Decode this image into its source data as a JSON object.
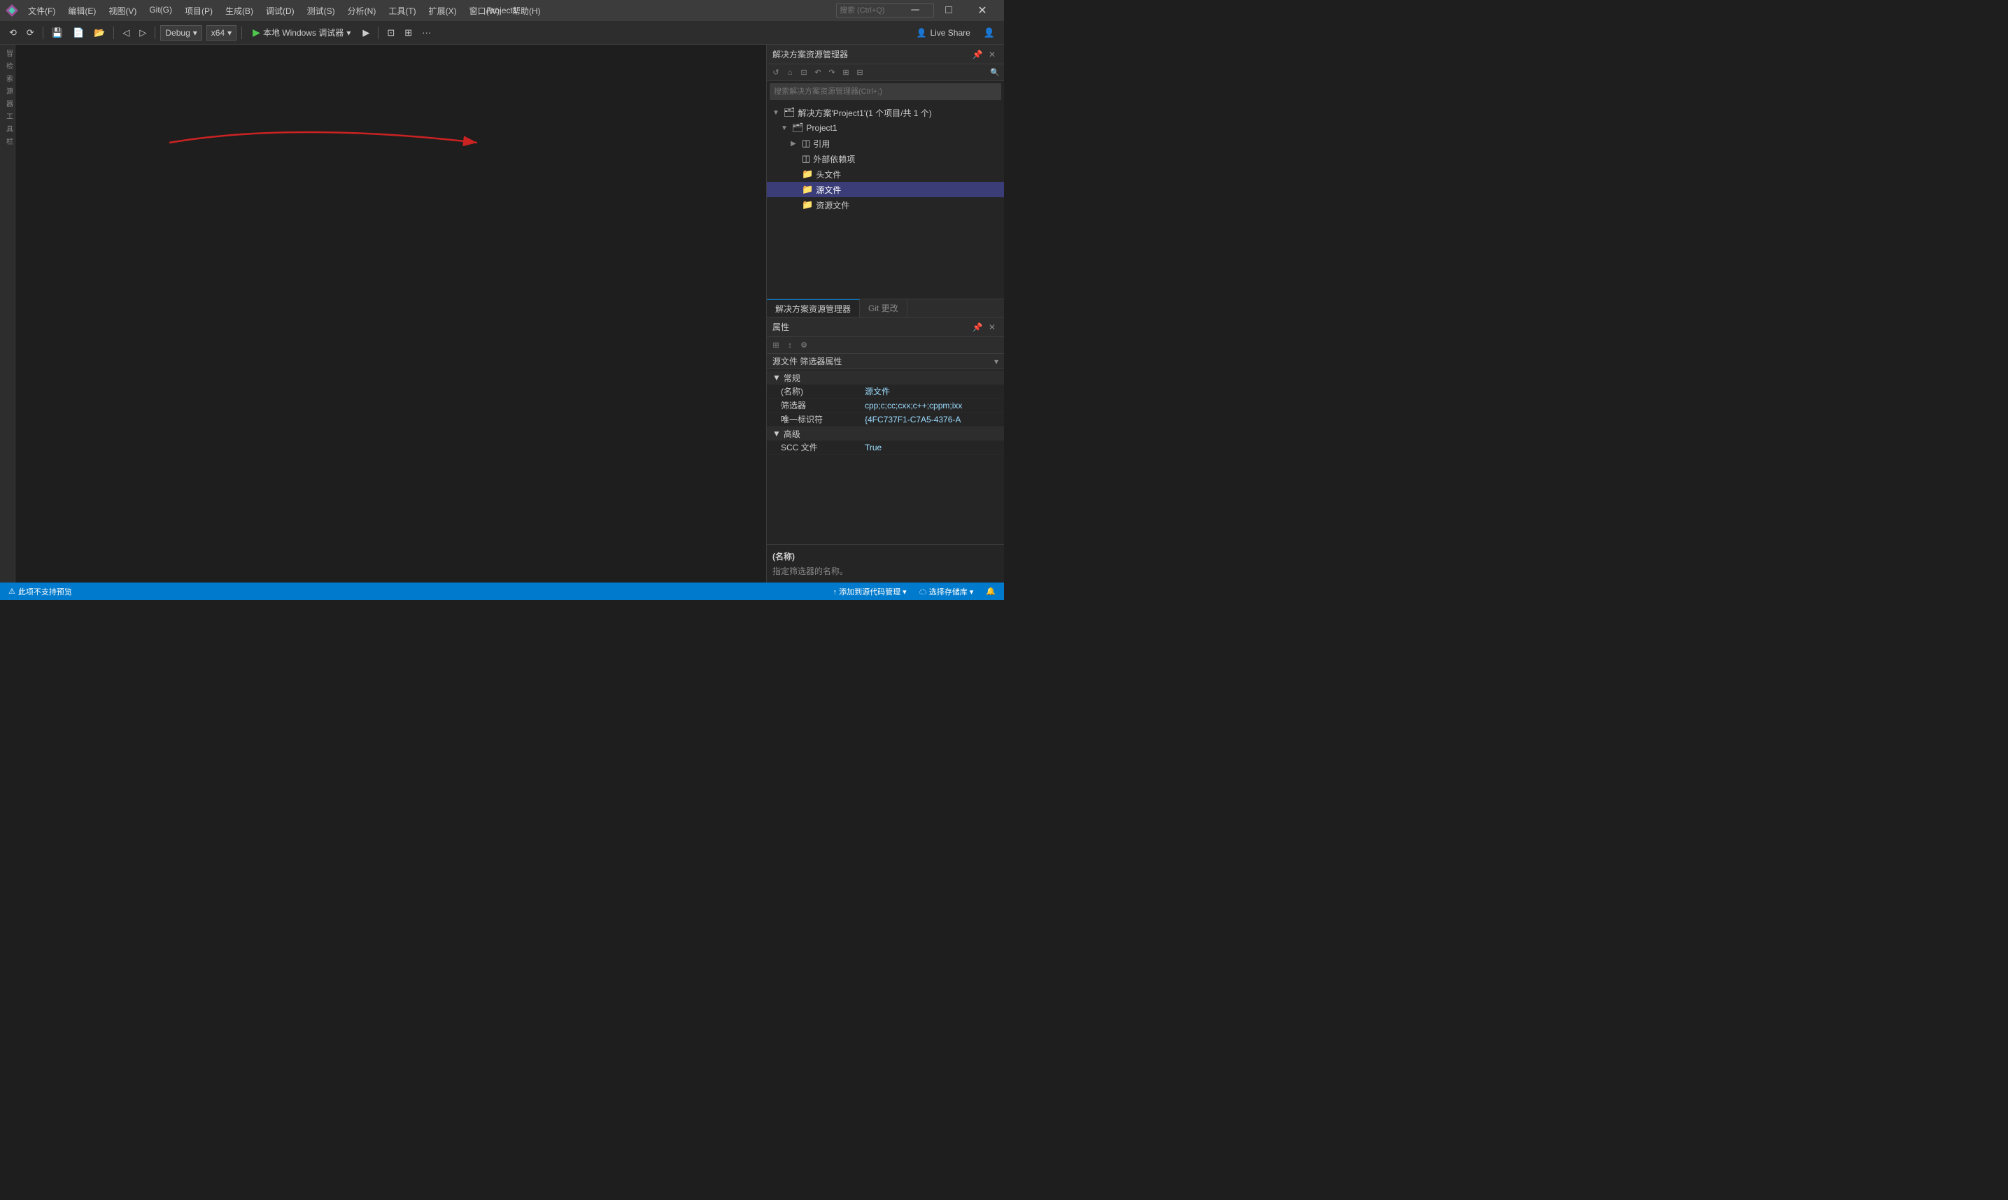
{
  "titleBar": {
    "title": "Project1",
    "menus": [
      {
        "label": "文件(F)",
        "key": "file"
      },
      {
        "label": "编辑(E)",
        "key": "edit"
      },
      {
        "label": "视图(V)",
        "key": "view"
      },
      {
        "label": "Git(G)",
        "key": "git"
      },
      {
        "label": "项目(P)",
        "key": "project"
      },
      {
        "label": "生成(B)",
        "key": "build"
      },
      {
        "label": "调试(D)",
        "key": "debug"
      },
      {
        "label": "测试(S)",
        "key": "test"
      },
      {
        "label": "分析(N)",
        "key": "analyze"
      },
      {
        "label": "工具(T)",
        "key": "tools"
      },
      {
        "label": "扩展(X)",
        "key": "extensions"
      },
      {
        "label": "窗口(W)",
        "key": "window"
      },
      {
        "label": "帮助(H)",
        "key": "help"
      }
    ],
    "search_placeholder": "搜索 (Ctrl+Q)",
    "controls": {
      "minimize": "─",
      "maximize": "□",
      "close": "✕"
    }
  },
  "toolbar": {
    "debug_config": "Debug",
    "platform": "x64",
    "run_label": "本地 Windows 调试器",
    "live_share_label": "Live Share"
  },
  "solutionExplorer": {
    "title": "解决方案资源管理器",
    "search_placeholder": "搜索解决方案资源管理器(Ctrl+;)",
    "solution_label": "解决方案'Project1'(1 个项目/共 1 个)",
    "project_label": "Project1",
    "items": [
      {
        "label": "引用",
        "indent": 3,
        "icon": "◫",
        "expandable": true
      },
      {
        "label": "外部依赖项",
        "indent": 2,
        "icon": "◫"
      },
      {
        "label": "头文件",
        "indent": 2,
        "icon": "📁"
      },
      {
        "label": "源文件",
        "indent": 2,
        "icon": "📁",
        "selected": true
      },
      {
        "label": "资源文件",
        "indent": 2,
        "icon": "📁"
      }
    ]
  },
  "panelTabs": [
    {
      "label": "解决方案资源管理器",
      "active": true
    },
    {
      "label": "Git 更改",
      "active": false
    }
  ],
  "properties": {
    "title": "属性",
    "selector_label": "源文件 筛选器属性",
    "sections": [
      {
        "label": "常规",
        "rows": [
          {
            "key": "(名称)",
            "value": "源文件"
          },
          {
            "key": "筛选器",
            "value": "cpp;c;cc;cxx;c++;cppm;ixx"
          },
          {
            "key": "唯一标识符",
            "value": "{4FC737F1-C7A5-4376-A"
          }
        ]
      },
      {
        "label": "高级",
        "rows": [
          {
            "key": "SCC 文件",
            "value": "True"
          }
        ]
      }
    ],
    "desc_title": "(名称)",
    "desc_text": "指定筛选器的名称。"
  },
  "statusBar": {
    "no_preview": "此项不支持预览",
    "add_to_source": "↑ 添加到源代码管理 ▾",
    "select_repo": "☁ 选择存储库 ▾",
    "notification_icon": "🔔"
  }
}
